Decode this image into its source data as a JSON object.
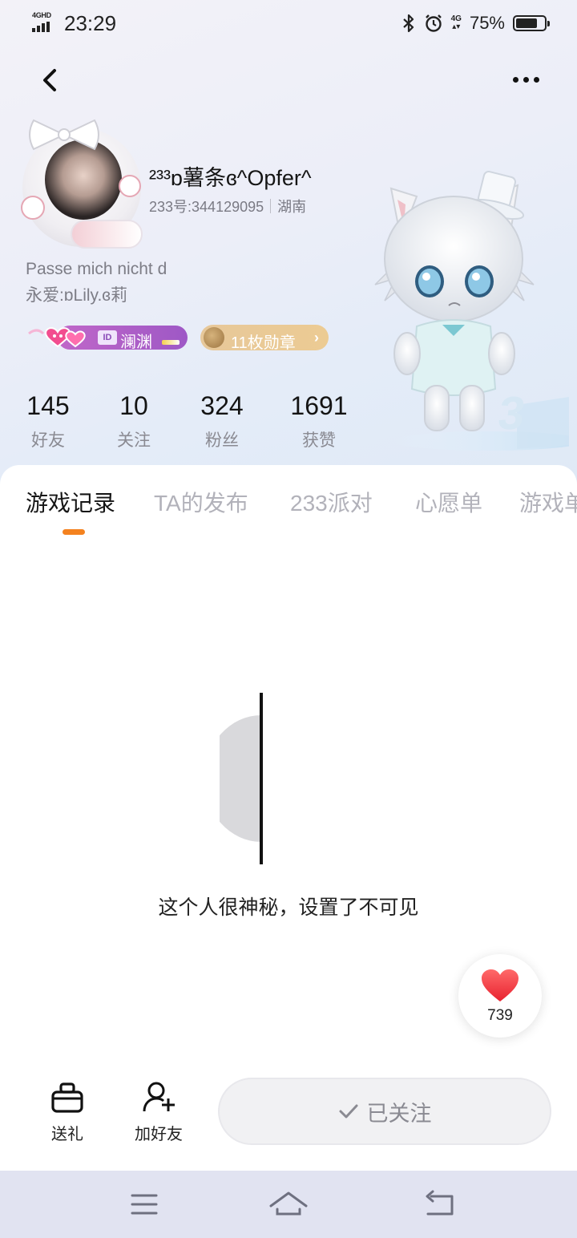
{
  "status_bar": {
    "network": "4GHD",
    "time": "23:29",
    "icons": [
      "bluetooth-icon",
      "alarm-icon",
      "4g-icon"
    ],
    "network2": "4G",
    "battery_text": "75%",
    "battery_level": 0.75
  },
  "profile": {
    "username": "²³³ɒ薯条ɞ^Opfer^",
    "id_text": "233号:344129095",
    "location": "湖南",
    "bio_line1": "Passe mich nicht d",
    "bio_line2": "永爱:ɒLily.ɞ莉",
    "badge_id_tag": "ID",
    "badge_id_text": "澜渊",
    "badge_medal_text": "11枚勋章",
    "badge_medal_arrow": "›"
  },
  "stats": [
    {
      "value": "145",
      "label": "好友"
    },
    {
      "value": "10",
      "label": "关注"
    },
    {
      "value": "324",
      "label": "粉丝"
    },
    {
      "value": "1691",
      "label": "获赞"
    }
  ],
  "tabs": [
    {
      "label": "游戏记录",
      "active": true
    },
    {
      "label": "TA的发布",
      "active": false
    },
    {
      "label": "233派对",
      "active": false
    },
    {
      "label": "心愿单",
      "active": false
    },
    {
      "label": "游戏单",
      "active": false
    }
  ],
  "content": {
    "empty_text": "这个人很神秘，设置了不可见"
  },
  "like": {
    "count": "739"
  },
  "actions": {
    "gift_label": "送礼",
    "add_friend_label": "加好友",
    "follow_label": "已关注"
  },
  "colors": {
    "accent": "#f4821f",
    "like_red": "#f2424e",
    "badge_purple": "#b062c8",
    "badge_gold": "#e9c896"
  }
}
